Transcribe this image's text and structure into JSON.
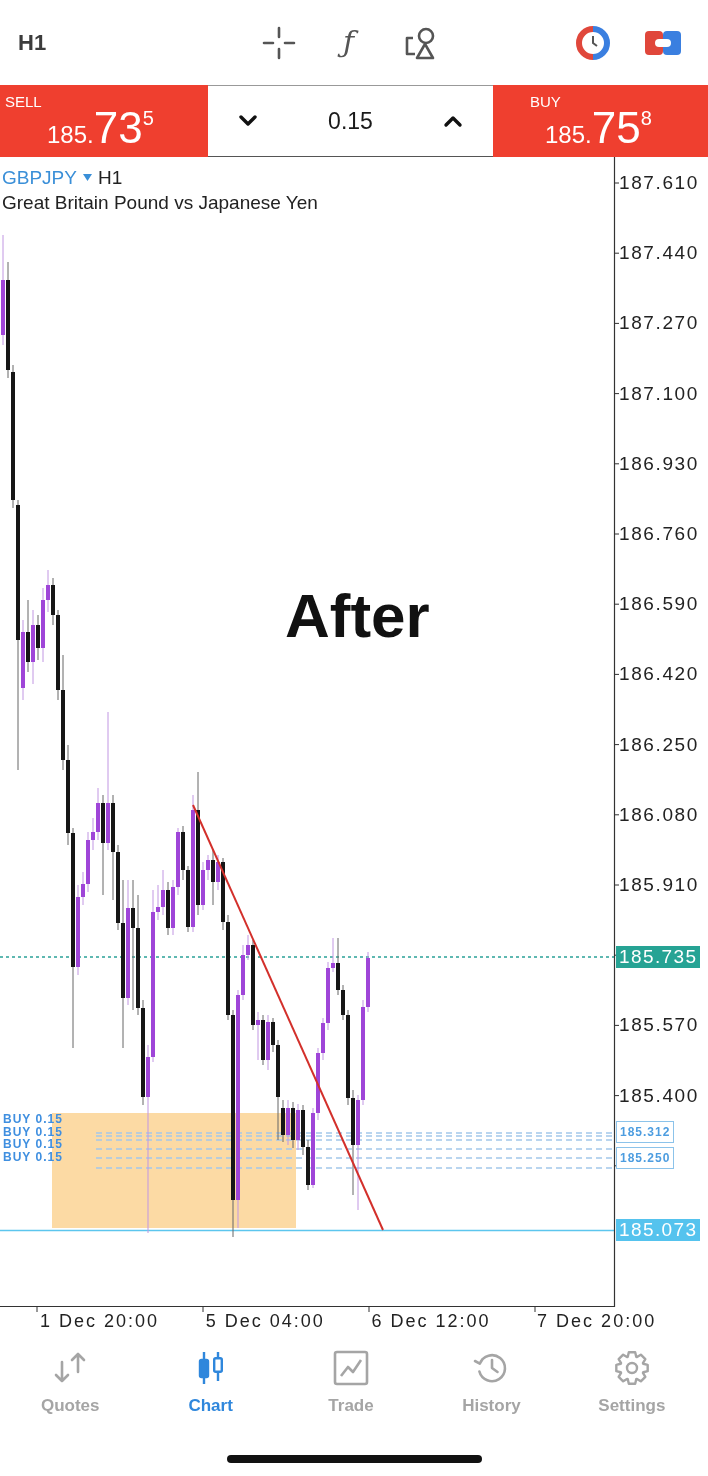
{
  "toolbar": {
    "timeframe": "H1",
    "indicators_symbol": "ƒ"
  },
  "trade_panel": {
    "sell": {
      "label": "SELL",
      "price_prefix": "185.",
      "price_main": "73",
      "price_pip": "5"
    },
    "volume": "0.15",
    "buy": {
      "label": "BUY",
      "price_prefix": "185.",
      "price_main": "75",
      "price_pip": "8"
    }
  },
  "chart": {
    "symbol": "GBPJPY",
    "timeframe": "H1",
    "description": "Great Britain Pound vs Japanese Yen",
    "annotation": "After",
    "price_axis": [
      "187.610",
      "187.440",
      "187.270",
      "187.100",
      "186.930",
      "186.760",
      "186.590",
      "186.420",
      "186.250",
      "186.080",
      "185.910",
      "185.570",
      "185.400"
    ],
    "price_tags": [
      {
        "text": "185.735",
        "kind": "current"
      },
      {
        "text": "185.312",
        "kind": "order"
      },
      {
        "text": "185.250",
        "kind": "order"
      },
      {
        "text": "185.073",
        "kind": "level"
      }
    ],
    "order_labels": [
      "BUY 0.15",
      "BUY 0.15",
      "BUY 0.15",
      "BUY 0.15"
    ],
    "time_axis": [
      "1 Dec 20:00",
      "5 Dec 04:00",
      "6 Dec 12:00",
      "7 Dec 20:00"
    ]
  },
  "nav": [
    {
      "label": "Quotes",
      "selected": false
    },
    {
      "label": "Chart",
      "selected": true
    },
    {
      "label": "Trade",
      "selected": false
    },
    {
      "label": "History",
      "selected": false
    },
    {
      "label": "Settings",
      "selected": false
    }
  ]
}
